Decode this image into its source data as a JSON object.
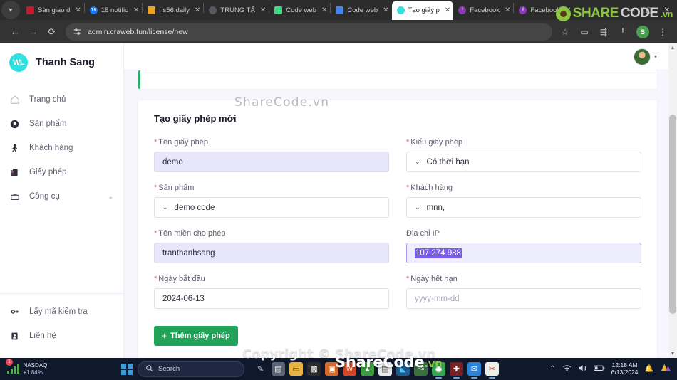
{
  "browser": {
    "tab_list_icon": "chevron-down-icon",
    "tabs": [
      {
        "title": "Sàn giao d",
        "favicon_label": "",
        "favicon_color": "#c9182b",
        "active": false
      },
      {
        "title": "18 notific",
        "favicon_label": "18",
        "favicon_color": "#1877f2",
        "active": false
      },
      {
        "title": "ns56.daily",
        "favicon_label": "",
        "favicon_color": "#f0a020",
        "active": false
      },
      {
        "title": "TRUNG TÂ",
        "favicon_label": "",
        "favicon_color": "#555a60",
        "active": false
      },
      {
        "title": "Code web",
        "favicon_label": "",
        "favicon_color": "#3ddc84",
        "active": false
      },
      {
        "title": "Code web",
        "favicon_label": "",
        "favicon_color": "#4285f4",
        "active": false
      },
      {
        "title": "Tạo giấy p",
        "favicon_label": "",
        "favicon_color": "#2fe0e0",
        "active": true
      },
      {
        "title": "Facebook",
        "favicon_label": "f",
        "favicon_color": "#8a3ab9",
        "active": false
      },
      {
        "title": "Facebook",
        "favicon_label": "f",
        "favicon_color": "#8a3ab9",
        "active": false
      }
    ],
    "close_label": "✕",
    "window_controls": {
      "minimize": "—",
      "maximize": "▢",
      "close": "✕"
    },
    "back_icon": "arrow-left-icon",
    "forward_icon": "arrow-right-icon",
    "reload_icon": "reload-icon",
    "site_settings_icon": "site-settings-icon",
    "url": "admin.craweb.fun/license/new",
    "bookmark_icon": "star-icon",
    "sidepanel_icon": "side-panel-icon",
    "reading_list_icon": "reading-list-icon",
    "downloads_icon": "download-icon",
    "profile_initial": "S",
    "menu_icon": "kebab-menu-icon"
  },
  "watermark": {
    "top_share": "SHARE",
    "top_code": "CODE",
    "top_vn": ".vn",
    "form_text": "ShareCode.vn",
    "copyright": "Copyright © ShareCode.vn",
    "taskbar_main": "ShareCode",
    "taskbar_vn": ".vn"
  },
  "sidebar": {
    "logo_text": "WL",
    "brand_name": "Thanh Sang",
    "items": [
      {
        "label": "Trang chủ",
        "icon": "home-icon"
      },
      {
        "label": "Sản phẩm",
        "icon": "product-icon"
      },
      {
        "label": "Khách hàng",
        "icon": "customer-icon"
      },
      {
        "label": "Giấy phép",
        "icon": "license-icon"
      },
      {
        "label": "Công cụ",
        "icon": "toolbox-icon",
        "chevron": "chevron-down-icon"
      }
    ],
    "bottom_items": [
      {
        "label": "Lấy mã kiểm tra",
        "icon": "key-icon"
      },
      {
        "label": "Liên hệ",
        "icon": "contact-icon"
      }
    ]
  },
  "topbar": {
    "avatar": "user-avatar",
    "caret": "▾"
  },
  "form": {
    "title": "Tạo giấy phép mới",
    "fields": [
      {
        "label": "Tên giấy phép",
        "required": true,
        "type": "text",
        "value": "demo",
        "placeholder": "",
        "state": "filled"
      },
      {
        "label": "Kiểu giấy phép",
        "required": true,
        "type": "select",
        "value": "Có thời hạn",
        "placeholder": "",
        "state": "normal"
      },
      {
        "label": "Sản phẩm",
        "required": true,
        "type": "select",
        "value": "demo code",
        "placeholder": "",
        "state": "normal"
      },
      {
        "label": "Khách hàng",
        "required": true,
        "type": "select",
        "value": "mnn,",
        "placeholder": "",
        "state": "normal"
      },
      {
        "label": "Tên miền cho phép",
        "required": true,
        "type": "text",
        "value": "tranthanhsang",
        "placeholder": "",
        "state": "filled"
      },
      {
        "label": "Địa chỉ IP",
        "required": false,
        "type": "text",
        "value": "107.274.988",
        "placeholder": "",
        "state": "selected"
      },
      {
        "label": "Ngày bắt đầu",
        "required": true,
        "type": "date",
        "value": "2024-06-13",
        "placeholder": "yyyy-mm-dd",
        "state": "normal"
      },
      {
        "label": "Ngày hết hạn",
        "required": true,
        "type": "date",
        "value": "",
        "placeholder": "yyyy-mm-dd",
        "state": "empty"
      }
    ],
    "submit_label": "Thêm giấy phép",
    "submit_plus": "+",
    "required_mark": "*"
  },
  "taskbar": {
    "widget": {
      "name": "NASDAQ",
      "change": "+1.84%",
      "badge": "1"
    },
    "start_icon": "windows-start-icon",
    "search_placeholder": "Search",
    "search_icon": "search-icon",
    "apps": [
      {
        "name": "copilot-icon",
        "glyph": "✎"
      },
      {
        "name": "file-explorer-icon",
        "glyph": "🗂"
      },
      {
        "name": "folder-icon",
        "glyph": "📁"
      },
      {
        "name": "photos-icon",
        "glyph": "🖼"
      },
      {
        "name": "office-icon",
        "glyph": "▩"
      },
      {
        "name": "word-icon",
        "glyph": "W"
      },
      {
        "name": "anydesk-icon",
        "glyph": "▲"
      },
      {
        "name": "notepad-icon",
        "glyph": "▤"
      },
      {
        "name": "vscode-icon",
        "glyph": "◢"
      },
      {
        "name": "heidisql-icon",
        "glyph": "HS"
      },
      {
        "name": "chrome-icon",
        "glyph": "◉"
      },
      {
        "name": "app-red-icon",
        "glyph": "✚"
      },
      {
        "name": "mail-icon",
        "glyph": "✉"
      },
      {
        "name": "snipping-tool-icon",
        "glyph": "✂"
      }
    ],
    "tray": {
      "overflow_icon": "chevron-up-icon",
      "wifi_icon": "wifi-icon",
      "volume_icon": "volume-icon",
      "battery_icon": "battery-icon",
      "time": "12:18 AM",
      "date": "6/13/2024",
      "bell_icon": "notification-bell-icon",
      "widget_icon": "colorful-widget-icon"
    }
  }
}
